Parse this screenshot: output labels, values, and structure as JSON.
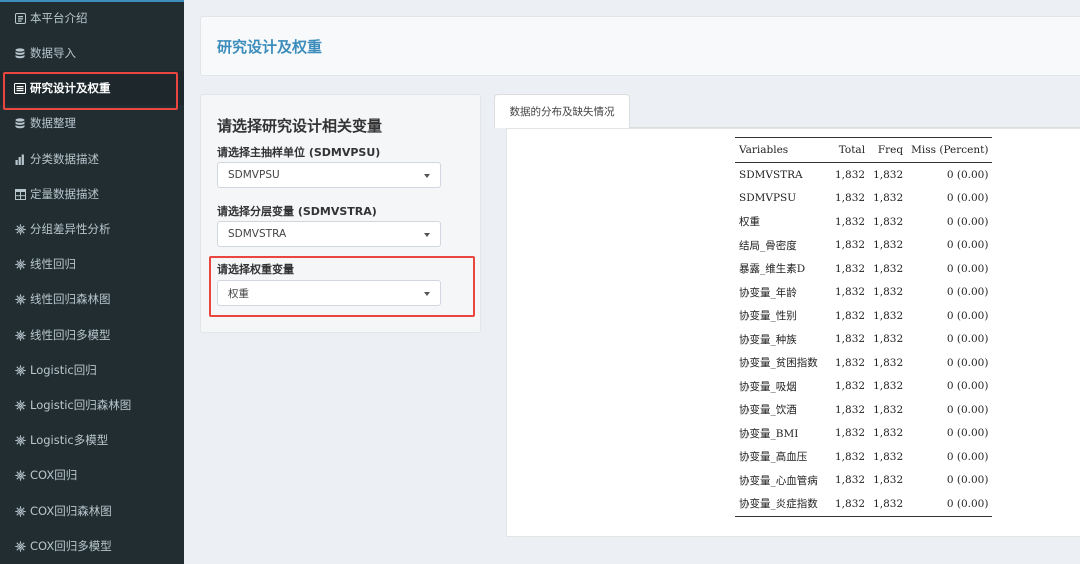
{
  "sidebar": {
    "items": [
      {
        "label": "本平台介绍",
        "icon": "info-card-icon"
      },
      {
        "label": "数据导入",
        "icon": "database-icon"
      },
      {
        "label": "研究设计及权重",
        "icon": "list-box-icon"
      },
      {
        "label": "数据整理",
        "icon": "database-icon"
      },
      {
        "label": "分类数据描述",
        "icon": "bar-chart-icon"
      },
      {
        "label": "定量数据描述",
        "icon": "table-icon"
      },
      {
        "label": "分组差异性分析",
        "icon": "gear-icon"
      },
      {
        "label": "线性回归",
        "icon": "gear-icon"
      },
      {
        "label": "线性回归森林图",
        "icon": "gear-icon"
      },
      {
        "label": "线性回归多模型",
        "icon": "gear-icon"
      },
      {
        "label": "Logistic回归",
        "icon": "gear-icon"
      },
      {
        "label": "Logistic回归森林图",
        "icon": "gear-icon"
      },
      {
        "label": "Logistic多模型",
        "icon": "gear-icon"
      },
      {
        "label": "COX回归",
        "icon": "gear-icon"
      },
      {
        "label": "COX回归森林图",
        "icon": "gear-icon"
      },
      {
        "label": "COX回归多模型",
        "icon": "gear-icon"
      }
    ],
    "active_index": 2
  },
  "header": {
    "title": "研究设计及权重"
  },
  "form": {
    "title": "请选择研究设计相关变量",
    "psu": {
      "label": "请选择主抽样单位 (SDMVPSU)",
      "value": "SDMVPSU"
    },
    "strata": {
      "label": "请选择分层变量 (SDMVSTRA)",
      "value": "SDMVSTRA"
    },
    "weight": {
      "label": "请选择权重变量",
      "value": "权重"
    }
  },
  "tabs": [
    {
      "label": "数据的分布及缺失情况"
    }
  ],
  "table": {
    "headers": [
      "Variables",
      "Total",
      "Freq",
      "Miss (Percent)"
    ],
    "rows": [
      [
        "SDMVSTRA",
        "1,832",
        "1,832",
        "0 (0.00)"
      ],
      [
        "SDMVPSU",
        "1,832",
        "1,832",
        "0 (0.00)"
      ],
      [
        "权重",
        "1,832",
        "1,832",
        "0 (0.00)"
      ],
      [
        "结局_骨密度",
        "1,832",
        "1,832",
        "0 (0.00)"
      ],
      [
        "暴露_维生素D",
        "1,832",
        "1,832",
        "0 (0.00)"
      ],
      [
        "协变量_年龄",
        "1,832",
        "1,832",
        "0 (0.00)"
      ],
      [
        "协变量_性别",
        "1,832",
        "1,832",
        "0 (0.00)"
      ],
      [
        "协变量_种族",
        "1,832",
        "1,832",
        "0 (0.00)"
      ],
      [
        "协变量_贫困指数",
        "1,832",
        "1,832",
        "0 (0.00)"
      ],
      [
        "协变量_吸烟",
        "1,832",
        "1,832",
        "0 (0.00)"
      ],
      [
        "协变量_饮酒",
        "1,832",
        "1,832",
        "0 (0.00)"
      ],
      [
        "协变量_BMI",
        "1,832",
        "1,832",
        "0 (0.00)"
      ],
      [
        "协变量_高血压",
        "1,832",
        "1,832",
        "0 (0.00)"
      ],
      [
        "协变量_心血管病",
        "1,832",
        "1,832",
        "0 (0.00)"
      ],
      [
        "协变量_炎症指数",
        "1,832",
        "1,832",
        "0 (0.00)"
      ]
    ]
  },
  "colors": {
    "sidebar_bg": "#222d32",
    "accent": "#3c8dbc",
    "highlight": "#e8463f"
  }
}
